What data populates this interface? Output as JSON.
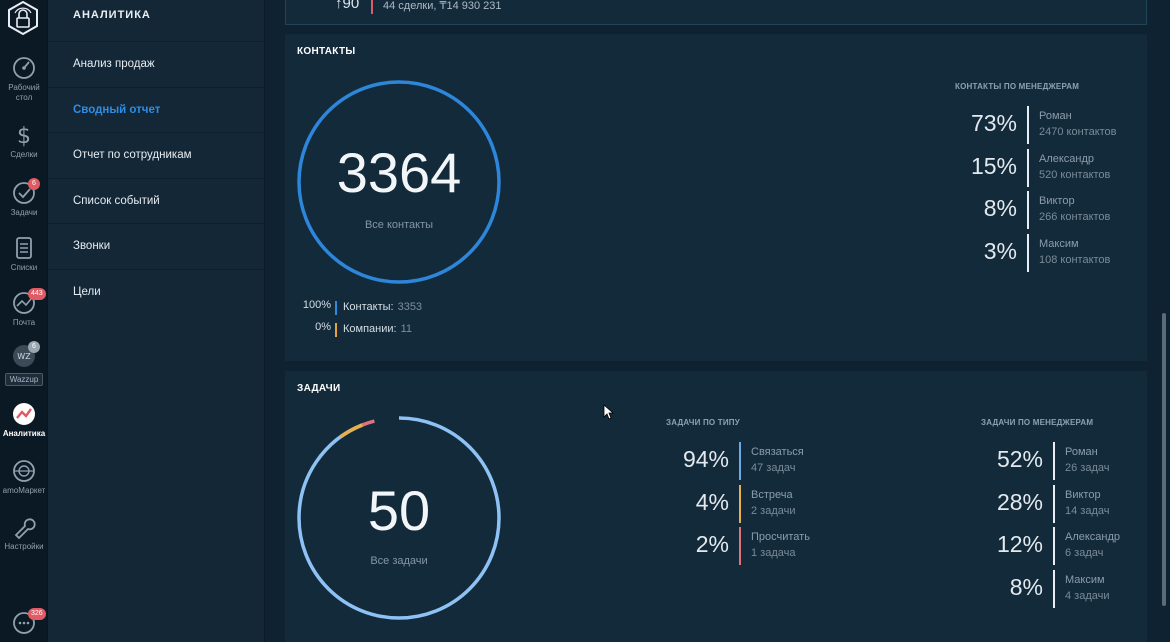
{
  "rail": {
    "items": [
      {
        "label": "Рабочий стол",
        "icon": "dashboard-icon"
      },
      {
        "label": "Сделки",
        "icon": "dollar-icon"
      },
      {
        "label": "Задачи",
        "icon": "check-icon",
        "badge": "6"
      },
      {
        "label": "Списки",
        "icon": "lists-icon"
      },
      {
        "label": "Почта",
        "icon": "mail-icon",
        "badge": "443"
      },
      {
        "label": "Wazzup",
        "icon": "wazzup-icon",
        "badge": "6"
      },
      {
        "label": "Аналитика",
        "icon": "analytics-icon"
      },
      {
        "label": "amoМаркет",
        "icon": "market-icon"
      },
      {
        "label": "Настройки",
        "icon": "settings-icon"
      },
      {
        "label": "",
        "icon": "chat-icon",
        "badge": "326"
      }
    ],
    "wazzup_text": "WZ"
  },
  "submenu": {
    "title": "АНАЛИТИКА",
    "items": [
      {
        "label": "Анализ продаж"
      },
      {
        "label": "Сводный отчет",
        "active": true
      },
      {
        "label": "Отчет по сотрудникам"
      },
      {
        "label": "Список событий"
      },
      {
        "label": "Звонки"
      },
      {
        "label": "Цели"
      }
    ]
  },
  "prev_card": {
    "value": "↑90",
    "text": "44 сделки, ₸14 930 231"
  },
  "contacts": {
    "title": "КОНТАКТЫ",
    "total": "3364",
    "total_label": "Все контакты",
    "legend": [
      {
        "pct": "100%",
        "name": "Контакты:",
        "value": "3353",
        "color": "#2d8ae0"
      },
      {
        "pct": "0%",
        "name": "Компании:",
        "value": "11",
        "color": "#e6a23c"
      }
    ],
    "by_manager_title": "КОНТАКТЫ ПО МЕНЕДЖЕРАМ",
    "by_manager": [
      {
        "pct": "73%",
        "name": "Роман",
        "sub": "2470 контактов"
      },
      {
        "pct": "15%",
        "name": "Александр",
        "sub": "520 контактов"
      },
      {
        "pct": "8%",
        "name": "Виктор",
        "sub": "266 контактов"
      },
      {
        "pct": "3%",
        "name": "Максим",
        "sub": "108 контактов"
      }
    ]
  },
  "tasks": {
    "title": "ЗАДАЧИ",
    "total": "50",
    "total_label": "Все задачи",
    "by_type_title": "ЗАДАЧИ ПО ТИПУ",
    "by_type": [
      {
        "pct": "94%",
        "name": "Связаться",
        "sub": "47 задач",
        "color": "#6fa8e6"
      },
      {
        "pct": "4%",
        "name": "Встреча",
        "sub": "2 задачи",
        "color": "#e6b04a"
      },
      {
        "pct": "2%",
        "name": "Просчитать",
        "sub": "1 задача",
        "color": "#e0727a"
      }
    ],
    "by_manager_title": "ЗАДАЧИ ПО МЕНЕДЖЕРАМ",
    "by_manager": [
      {
        "pct": "52%",
        "name": "Роман",
        "sub": "26 задач"
      },
      {
        "pct": "28%",
        "name": "Виктор",
        "sub": "14 задач"
      },
      {
        "pct": "12%",
        "name": "Александр",
        "sub": "6 задач"
      },
      {
        "pct": "8%",
        "name": "Максим",
        "sub": "4 задачи"
      }
    ]
  },
  "colors": {
    "accent": "#2f8de4",
    "ring_contacts": "#2d86d9",
    "ring_tasks": "#8ec2f4",
    "badge": "#e05b64"
  }
}
